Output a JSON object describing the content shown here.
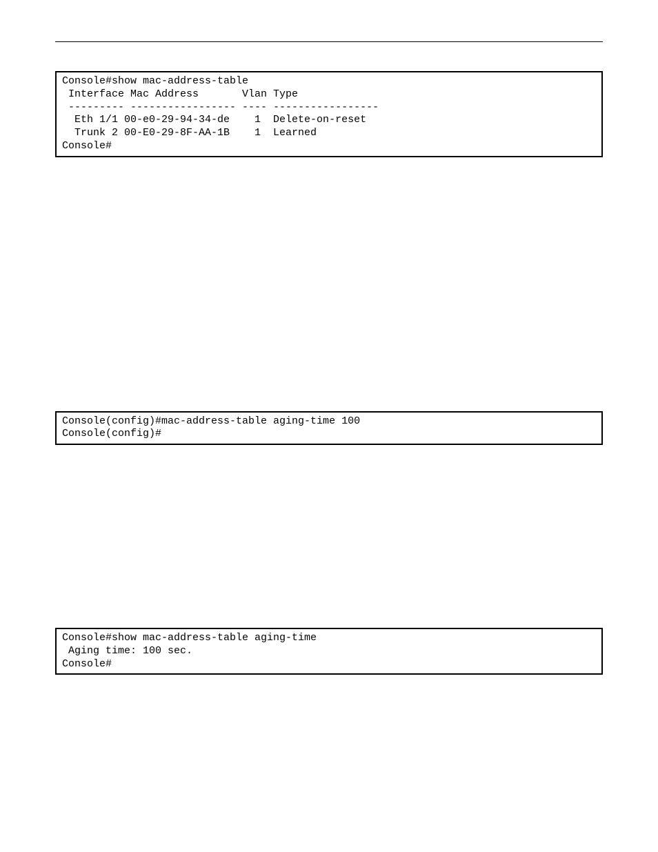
{
  "terminal1": {
    "lines": [
      "Console#show mac-address-table",
      " Interface Mac Address       Vlan Type",
      " --------- ----------------- ---- -----------------",
      "  Eth 1/1 00-e0-29-94-34-de    1  Delete-on-reset",
      "  Trunk 2 00-E0-29-8F-AA-1B    1  Learned",
      "Console#"
    ]
  },
  "terminal2": {
    "lines": [
      "Console(config)#mac-address-table aging-time 100",
      "Console(config)#"
    ]
  },
  "terminal3": {
    "lines": [
      "Console#show mac-address-table aging-time",
      " Aging time: 100 sec.",
      "Console#"
    ]
  }
}
